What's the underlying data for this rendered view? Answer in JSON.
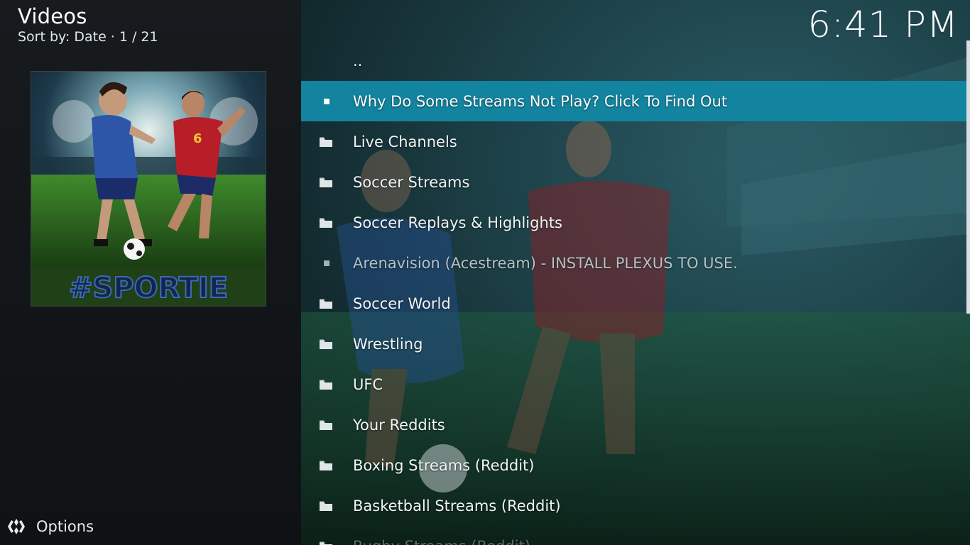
{
  "header": {
    "title": "Videos",
    "sort_label": "Sort by: Date",
    "separator": "·",
    "position": "1 / 21"
  },
  "clock": "6:41 PM",
  "thumbnail": {
    "logo_text": "#SPORTIE"
  },
  "options": {
    "label": "Options",
    "icon": "options-icon"
  },
  "list": {
    "parent": "..",
    "items": [
      {
        "label": "Why Do Some Streams Not Play? Click To Find Out",
        "icon": "bullet-icon",
        "selected": true
      },
      {
        "label": "Live Channels",
        "icon": "folder-icon"
      },
      {
        "label": "Soccer Streams",
        "icon": "folder-icon"
      },
      {
        "label": "Soccer Replays & Highlights",
        "icon": "folder-icon"
      },
      {
        "label": "Arenavision (Acestream) - INSTALL PLEXUS TO USE.",
        "icon": "bullet-icon",
        "dim": true
      },
      {
        "label": "Soccer World",
        "icon": "folder-icon"
      },
      {
        "label": "Wrestling",
        "icon": "folder-icon"
      },
      {
        "label": "UFC",
        "icon": "folder-icon"
      },
      {
        "label": "Your Reddits",
        "icon": "folder-icon"
      },
      {
        "label": "Boxing Streams (Reddit)",
        "icon": "folder-icon"
      },
      {
        "label": "Basketball Streams (Reddit)",
        "icon": "folder-icon"
      },
      {
        "label": "Rugby Streams (Reddit)",
        "icon": "folder-icon"
      }
    ]
  },
  "colors": {
    "selection": "#12849f",
    "left_panel": "#15191c",
    "player_red": "#b81e28",
    "player_blue": "#2d55a8"
  }
}
